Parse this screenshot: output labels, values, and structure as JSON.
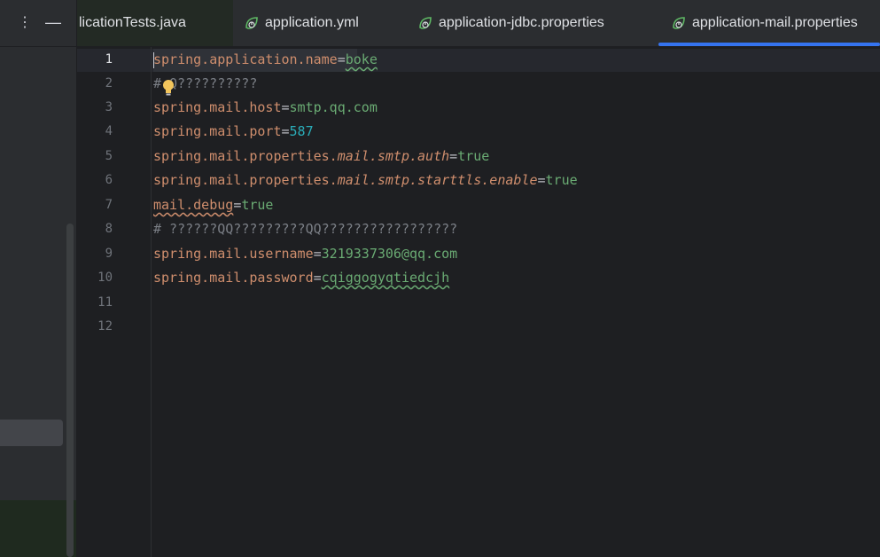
{
  "left_panel": {
    "kebab_icon": "more-vertical-icon",
    "minimize_icon": "minus-icon"
  },
  "tabs": [
    {
      "label": "licationTests.java",
      "icon": "spring-leaf-icon"
    },
    {
      "label": "application.yml",
      "icon": "spring-leaf-icon"
    },
    {
      "label": "application-jdbc.properties",
      "icon": "spring-leaf-icon"
    },
    {
      "label": "application-mail.properties",
      "icon": "spring-leaf-icon",
      "active": true
    }
  ],
  "colors": {
    "accent": "#3574f0",
    "key": "#cf8e6d",
    "value": "#6aab73",
    "number": "#2aacb8",
    "comment": "#7a7e85"
  },
  "editor": {
    "lines": [
      {
        "num": "1",
        "key": "spring.application.name",
        "eq": "=",
        "value": "boke"
      },
      {
        "num": "2",
        "comment_a": "#",
        "comment_b": "Q??????????"
      },
      {
        "num": "3",
        "key": "spring.mail.host",
        "eq": "=",
        "value": "smtp.qq.com"
      },
      {
        "num": "4",
        "key": "spring.mail.port",
        "eq": "=",
        "value": "587"
      },
      {
        "num": "5",
        "key": "spring.mail.properties.",
        "key_it": "mail.smtp.auth",
        "eq": "=",
        "value": "true"
      },
      {
        "num": "6",
        "key": "spring.mail.properties.",
        "key_it": "mail.smtp.starttls.enable",
        "eq": "=",
        "value": "true"
      },
      {
        "num": "7",
        "key": "mail.debug",
        "eq": "=",
        "value": "true"
      },
      {
        "num": "8",
        "comment": "# ??????QQ?????????QQ?????????????????"
      },
      {
        "num": "9",
        "key": "spring.mail.username",
        "eq": "=",
        "value": "3219337306@qq.com"
      },
      {
        "num": "10",
        "key": "spring.mail.password",
        "eq": "=",
        "value": "cqiggogyqtiedcjh"
      },
      {
        "num": "11"
      },
      {
        "num": "12"
      }
    ]
  }
}
